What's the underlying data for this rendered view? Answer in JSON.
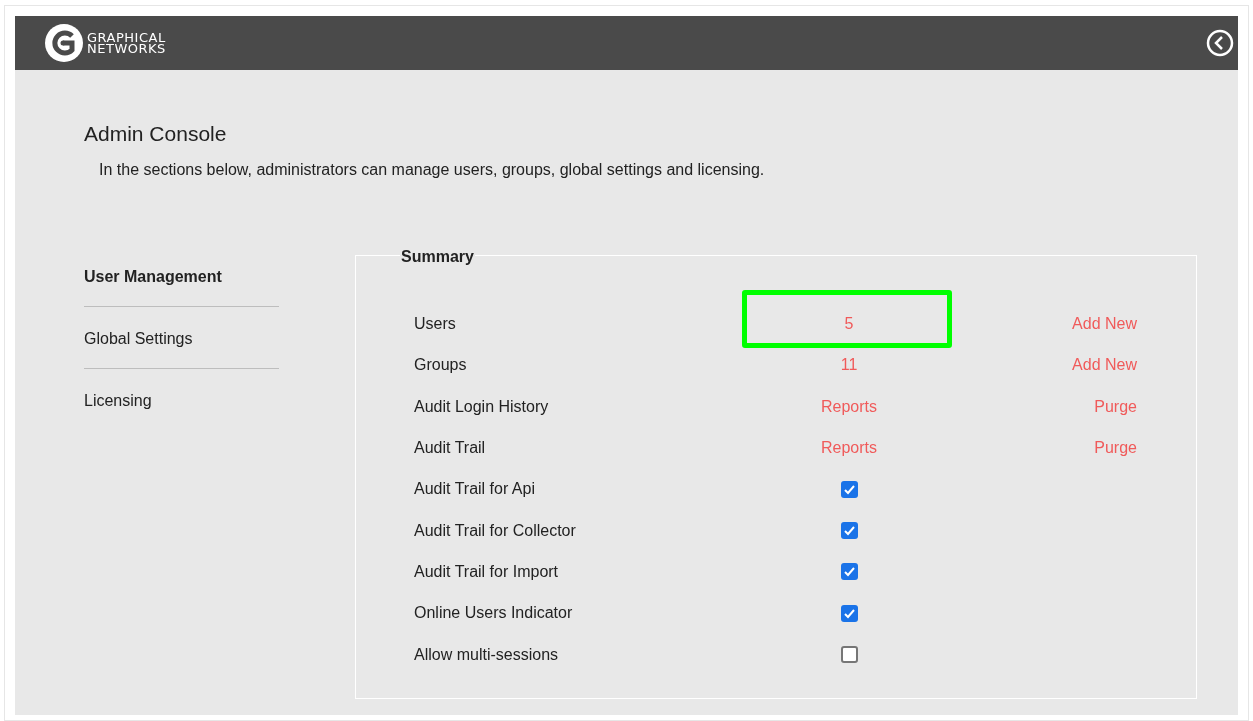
{
  "header": {
    "logo_text": [
      "GRAPHICAL",
      "NETWORKS"
    ]
  },
  "title": "Admin Console",
  "description": "In the sections below, administrators can manage users, groups, global settings and licensing.",
  "sidebar": {
    "items": [
      {
        "label": "User Management",
        "selected": true
      },
      {
        "label": "Global Settings",
        "selected": false
      },
      {
        "label": "Licensing",
        "selected": false
      }
    ]
  },
  "summary": {
    "legend": "Summary",
    "rows": [
      {
        "kind": "links",
        "label": "Users",
        "value": "5",
        "action": "Add New",
        "highlighted": true
      },
      {
        "kind": "links",
        "label": "Groups",
        "value": "11",
        "action": "Add New",
        "highlighted": false
      },
      {
        "kind": "links",
        "label": "Audit Login History",
        "value": "Reports",
        "action": "Purge",
        "highlighted": false
      },
      {
        "kind": "links",
        "label": "Audit Trail",
        "value": "Reports",
        "action": "Purge",
        "highlighted": false
      },
      {
        "kind": "checkbox",
        "label": "Audit Trail for Api",
        "checked": true
      },
      {
        "kind": "checkbox",
        "label": "Audit Trail for Collector",
        "checked": true
      },
      {
        "kind": "checkbox",
        "label": "Audit Trail for Import",
        "checked": true
      },
      {
        "kind": "checkbox",
        "label": "Online Users Indicator",
        "checked": true
      },
      {
        "kind": "checkbox",
        "label": "Allow multi-sessions",
        "checked": false
      }
    ]
  }
}
